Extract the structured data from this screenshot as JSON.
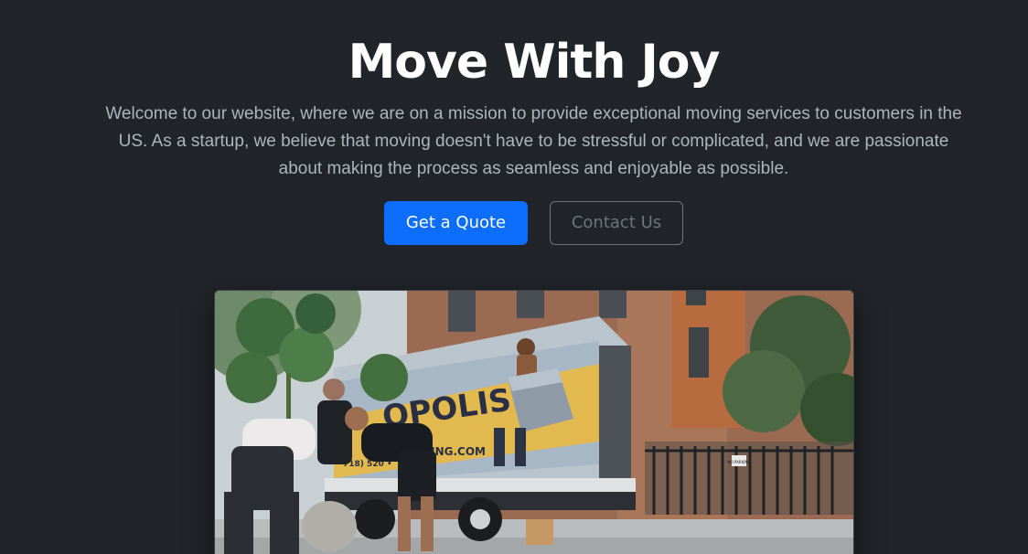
{
  "hero": {
    "title": "Move With Joy",
    "lead": "Welcome to our website, where we are on a mission to provide exceptional moving services to customers in the US. As a startup, we believe that moving doesn't have to be stressful or complicated, and we are passionate about making the process as seamless and enjoyable as possible.",
    "primary_button": "Get a Quote",
    "secondary_button": "Contact Us"
  },
  "photo": {
    "truck_brand": "OPOLIS",
    "truck_sub": "G",
    "truck_url": "MOVING.COM",
    "truck_phone": "718) 520 •",
    "sign_text": "NO PARKING"
  },
  "colors": {
    "background": "#212529",
    "primary": "#0d6efd",
    "secondary": "#6c757d",
    "lead_text": "#adb5bd"
  }
}
